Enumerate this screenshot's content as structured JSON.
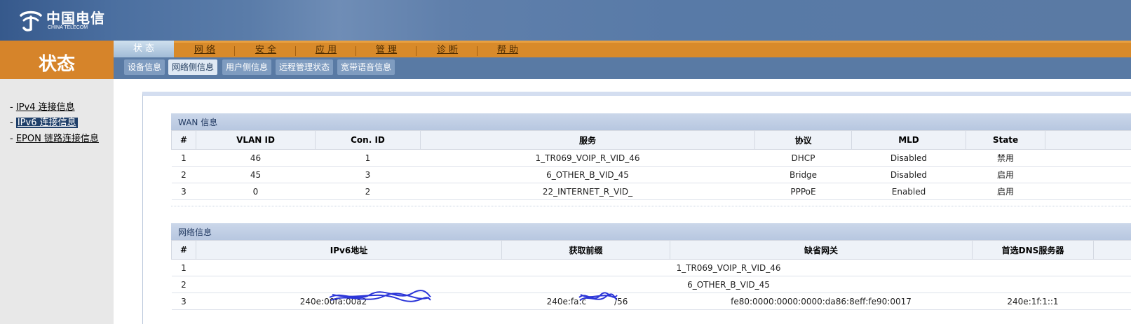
{
  "header": {
    "logo_cn": "中国电信",
    "logo_en": "CHINA TELECOM"
  },
  "status_block": {
    "title": "状态"
  },
  "main_nav": {
    "active": "状 态",
    "items": [
      "网 络",
      "安 全",
      "应 用",
      "管 理",
      "诊 断",
      "帮 助"
    ]
  },
  "sub_nav": {
    "items": [
      "设备信息",
      "网络侧信息",
      "用户侧信息",
      "远程管理状态",
      "宽带语音信息"
    ],
    "active_index": 1
  },
  "left_menu": {
    "prefix": "- ",
    "items": [
      "IPv4 连接信息",
      "IPv6 连接信息",
      "EPON 链路连接信息"
    ],
    "selected_index": 1
  },
  "wan": {
    "title": "WAN 信息",
    "columns": [
      "#",
      "VLAN ID",
      "Con. ID",
      "服务",
      "协议",
      "MLD",
      "State"
    ],
    "rows": [
      [
        "1",
        "46",
        "1",
        "1_TR069_VOIP_R_VID_46",
        "DHCP",
        "Disabled",
        "禁用"
      ],
      [
        "2",
        "45",
        "3",
        "6_OTHER_B_VID_45",
        "Bridge",
        "Disabled",
        "启用"
      ],
      [
        "3",
        "0",
        "2",
        "22_INTERNET_R_VID_",
        "PPPoE",
        "Enabled",
        "启用"
      ]
    ]
  },
  "net": {
    "title": "网络信息",
    "columns": [
      "#",
      "IPv6地址",
      "获取前缀",
      "缺省网关",
      "首选DNS服务器"
    ],
    "rows": [
      {
        "idx": "1",
        "span_text": "1_TR069_VOIP_R_VID_46"
      },
      {
        "idx": "2",
        "span_text": "6_OTHER_B_VID_45"
      }
    ],
    "row3": [
      "3",
      "240e:00fa:00a2",
      "240e:fa:c",
      "/56",
      "fe80:0000:0000:0000:da86:8eff:fe90:0017",
      "240e:1f:1::1"
    ]
  },
  "colors": {
    "header_blue": "#5a7aa4",
    "orange": "#d88a2a",
    "subnav_blue": "#597aa4",
    "section_head": "#b7c7e0",
    "scribble": "#2b35d8"
  }
}
